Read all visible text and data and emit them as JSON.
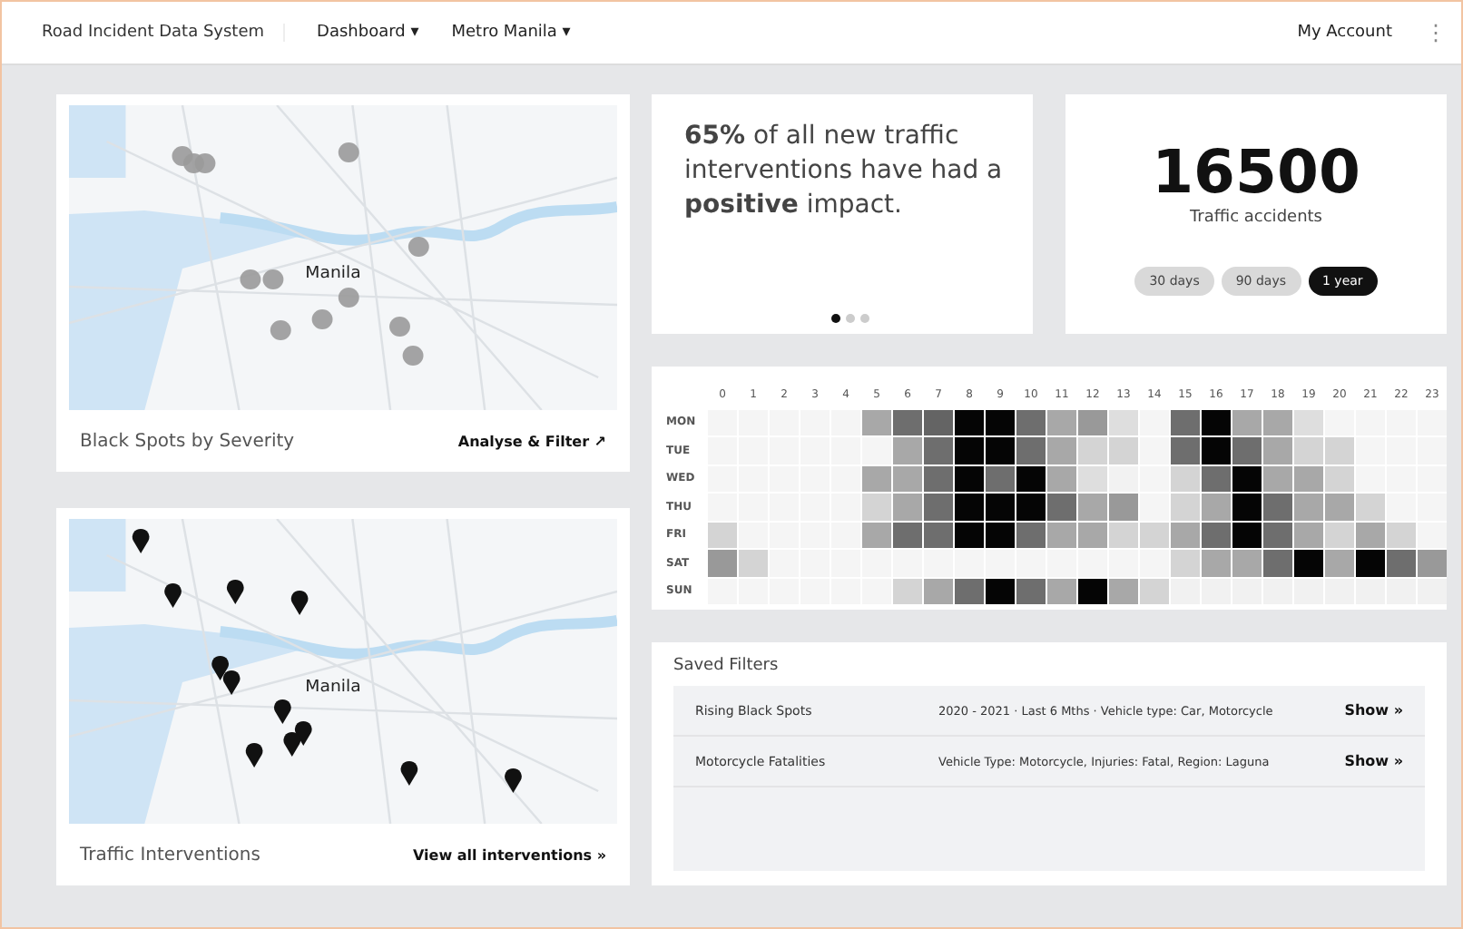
{
  "topbar": {
    "app_title": "Road Incident Data System",
    "menus": [
      {
        "label": "Dashboard ▾"
      },
      {
        "label": "Metro Manila ▾"
      }
    ],
    "account": "My Account",
    "more": "⋮"
  },
  "maps": [
    {
      "kind": "spots",
      "city": "Manila",
      "title": "Black Spots by Severity",
      "link": "Analyse & Filter ↗"
    },
    {
      "kind": "pins",
      "city": "Manila",
      "title": "Traffic Interventions",
      "link": "View all interventions »"
    }
  ],
  "insight": {
    "text": "**65%** of all new traffic interventions have had a **positive** impact.",
    "carousel": [
      {
        "selected": true
      },
      {
        "selected": false
      },
      {
        "selected": false
      }
    ]
  },
  "stat": {
    "value": "16500",
    "label": "Traffic accidents",
    "ranges": [
      {
        "label": "30 days",
        "selected": false
      },
      {
        "label": "90 days",
        "selected": false
      },
      {
        "label": "1 year",
        "selected": true
      }
    ]
  },
  "heatmap": {
    "hours": [
      "0",
      "1",
      "2",
      "3",
      "4",
      "5",
      "6",
      "7",
      "8",
      "9",
      "10",
      "11",
      "12",
      "13",
      "14",
      "15",
      "16",
      "17",
      "18",
      "19",
      "20",
      "21",
      "22",
      "23"
    ],
    "rows": [
      {
        "day": "MON",
        "cells": [
          {
            "color": "#f5f5f5"
          },
          {
            "color": "#f5f5f5"
          },
          {
            "color": "#f5f5f5"
          },
          {
            "color": "#f5f5f5"
          },
          {
            "color": "#f5f5f5"
          },
          {
            "color": "#a8a8a8"
          },
          {
            "color": "#6e6e6e"
          },
          {
            "color": "#646464"
          },
          {
            "color": "#050505"
          },
          {
            "color": "#050505"
          },
          {
            "color": "#6e6e6e"
          },
          {
            "color": "#a8a8a8"
          },
          {
            "color": "#999999"
          },
          {
            "color": "#dedede"
          },
          {
            "color": "#f5f5f5"
          },
          {
            "color": "#6e6e6e"
          },
          {
            "color": "#050505"
          },
          {
            "color": "#a8a8a8"
          },
          {
            "color": "#a8a8a8"
          },
          {
            "color": "#dedede"
          },
          {
            "color": "#f5f5f5"
          },
          {
            "color": "#f5f5f5"
          },
          {
            "color": "#f5f5f5"
          },
          {
            "color": "#f5f5f5"
          }
        ]
      },
      {
        "day": "TUE",
        "cells": [
          {
            "color": "#f5f5f5"
          },
          {
            "color": "#f5f5f5"
          },
          {
            "color": "#f5f5f5"
          },
          {
            "color": "#f5f5f5"
          },
          {
            "color": "#f5f5f5"
          },
          {
            "color": "#f5f5f5"
          },
          {
            "color": "#a8a8a8"
          },
          {
            "color": "#6e6e6e"
          },
          {
            "color": "#050505"
          },
          {
            "color": "#050505"
          },
          {
            "color": "#6e6e6e"
          },
          {
            "color": "#a8a8a8"
          },
          {
            "color": "#d4d4d4"
          },
          {
            "color": "#d4d4d4"
          },
          {
            "color": "#f5f5f5"
          },
          {
            "color": "#6e6e6e"
          },
          {
            "color": "#050505"
          },
          {
            "color": "#6e6e6e"
          },
          {
            "color": "#a8a8a8"
          },
          {
            "color": "#d4d4d4"
          },
          {
            "color": "#d4d4d4"
          },
          {
            "color": "#f5f5f5"
          },
          {
            "color": "#f5f5f5"
          },
          {
            "color": "#f5f5f5"
          }
        ]
      },
      {
        "day": "WED",
        "cells": [
          {
            "color": "#f5f5f5"
          },
          {
            "color": "#f5f5f5"
          },
          {
            "color": "#f5f5f5"
          },
          {
            "color": "#f5f5f5"
          },
          {
            "color": "#f5f5f5"
          },
          {
            "color": "#a8a8a8"
          },
          {
            "color": "#a8a8a8"
          },
          {
            "color": "#6e6e6e"
          },
          {
            "color": "#050505"
          },
          {
            "color": "#6e6e6e"
          },
          {
            "color": "#050505"
          },
          {
            "color": "#a8a8a8"
          },
          {
            "color": "#dedede"
          },
          {
            "color": "#f2f2f2"
          },
          {
            "color": "#f5f5f5"
          },
          {
            "color": "#d4d4d4"
          },
          {
            "color": "#6e6e6e"
          },
          {
            "color": "#050505"
          },
          {
            "color": "#a8a8a8"
          },
          {
            "color": "#a8a8a8"
          },
          {
            "color": "#d4d4d4"
          },
          {
            "color": "#f5f5f5"
          },
          {
            "color": "#f5f5f5"
          },
          {
            "color": "#f5f5f5"
          }
        ]
      },
      {
        "day": "THU",
        "cells": [
          {
            "color": "#f5f5f5"
          },
          {
            "color": "#f5f5f5"
          },
          {
            "color": "#f5f5f5"
          },
          {
            "color": "#f5f5f5"
          },
          {
            "color": "#f5f5f5"
          },
          {
            "color": "#d4d4d4"
          },
          {
            "color": "#a8a8a8"
          },
          {
            "color": "#6e6e6e"
          },
          {
            "color": "#050505"
          },
          {
            "color": "#050505"
          },
          {
            "color": "#050505"
          },
          {
            "color": "#6e6e6e"
          },
          {
            "color": "#a8a8a8"
          },
          {
            "color": "#999999"
          },
          {
            "color": "#f5f5f5"
          },
          {
            "color": "#d4d4d4"
          },
          {
            "color": "#a8a8a8"
          },
          {
            "color": "#050505"
          },
          {
            "color": "#6e6e6e"
          },
          {
            "color": "#a8a8a8"
          },
          {
            "color": "#a8a8a8"
          },
          {
            "color": "#d4d4d4"
          },
          {
            "color": "#f5f5f5"
          },
          {
            "color": "#f5f5f5"
          }
        ]
      },
      {
        "day": "FRI",
        "cells": [
          {
            "color": "#d4d4d4"
          },
          {
            "color": "#f5f5f5"
          },
          {
            "color": "#f5f5f5"
          },
          {
            "color": "#f5f5f5"
          },
          {
            "color": "#f5f5f5"
          },
          {
            "color": "#a8a8a8"
          },
          {
            "color": "#6e6e6e"
          },
          {
            "color": "#6e6e6e"
          },
          {
            "color": "#050505"
          },
          {
            "color": "#050505"
          },
          {
            "color": "#6e6e6e"
          },
          {
            "color": "#a8a8a8"
          },
          {
            "color": "#a8a8a8"
          },
          {
            "color": "#d4d4d4"
          },
          {
            "color": "#d4d4d4"
          },
          {
            "color": "#a8a8a8"
          },
          {
            "color": "#6e6e6e"
          },
          {
            "color": "#050505"
          },
          {
            "color": "#6e6e6e"
          },
          {
            "color": "#a8a8a8"
          },
          {
            "color": "#d4d4d4"
          },
          {
            "color": "#a8a8a8"
          },
          {
            "color": "#d4d4d4"
          },
          {
            "color": "#f5f5f5"
          }
        ]
      },
      {
        "day": "SAT",
        "cells": [
          {
            "color": "#999999"
          },
          {
            "color": "#d4d4d4"
          },
          {
            "color": "#f5f5f5"
          },
          {
            "color": "#f5f5f5"
          },
          {
            "color": "#f5f5f5"
          },
          {
            "color": "#f5f5f5"
          },
          {
            "color": "#f5f5f5"
          },
          {
            "color": "#f5f5f5"
          },
          {
            "color": "#f5f5f5"
          },
          {
            "color": "#f5f5f5"
          },
          {
            "color": "#f5f5f5"
          },
          {
            "color": "#f5f5f5"
          },
          {
            "color": "#f5f5f5"
          },
          {
            "color": "#f5f5f5"
          },
          {
            "color": "#f5f5f5"
          },
          {
            "color": "#d4d4d4"
          },
          {
            "color": "#a8a8a8"
          },
          {
            "color": "#a8a8a8"
          },
          {
            "color": "#6e6e6e"
          },
          {
            "color": "#050505"
          },
          {
            "color": "#a8a8a8"
          },
          {
            "color": "#050505"
          },
          {
            "color": "#6e6e6e"
          },
          {
            "color": "#999999"
          }
        ]
      },
      {
        "day": "SUN",
        "cells": [
          {
            "color": "#f5f5f5"
          },
          {
            "color": "#f5f5f5"
          },
          {
            "color": "#f5f5f5"
          },
          {
            "color": "#f5f5f5"
          },
          {
            "color": "#f5f5f5"
          },
          {
            "color": "#f5f5f5"
          },
          {
            "color": "#d4d4d4"
          },
          {
            "color": "#a8a8a8"
          },
          {
            "color": "#6e6e6e"
          },
          {
            "color": "#050505"
          },
          {
            "color": "#6e6e6e"
          },
          {
            "color": "#a8a8a8"
          },
          {
            "color": "#050505"
          },
          {
            "color": "#a8a8a8"
          },
          {
            "color": "#d4d4d4"
          },
          {
            "color": "#f1f1f1"
          },
          {
            "color": "#f1f1f1"
          },
          {
            "color": "#f1f1f1"
          },
          {
            "color": "#f1f1f1"
          },
          {
            "color": "#f1f1f1"
          },
          {
            "color": "#f1f1f1"
          },
          {
            "color": "#f1f1f1"
          },
          {
            "color": "#f1f1f1"
          },
          {
            "color": "#f1f1f1"
          }
        ]
      }
    ]
  },
  "saved_filters": {
    "title": "Saved Filters",
    "rows": [
      {
        "name": "Rising Black Spots",
        "criteria": "2020 - 2021 · Last 6 Mths · Vehicle type: Car, Motorcycle",
        "action": "Show »"
      },
      {
        "name": "Motorcycle Fatalities",
        "criteria": "Vehicle Type: Motorcycle, Injuries: Fatal, Region: Laguna",
        "action": "Show »"
      }
    ]
  }
}
